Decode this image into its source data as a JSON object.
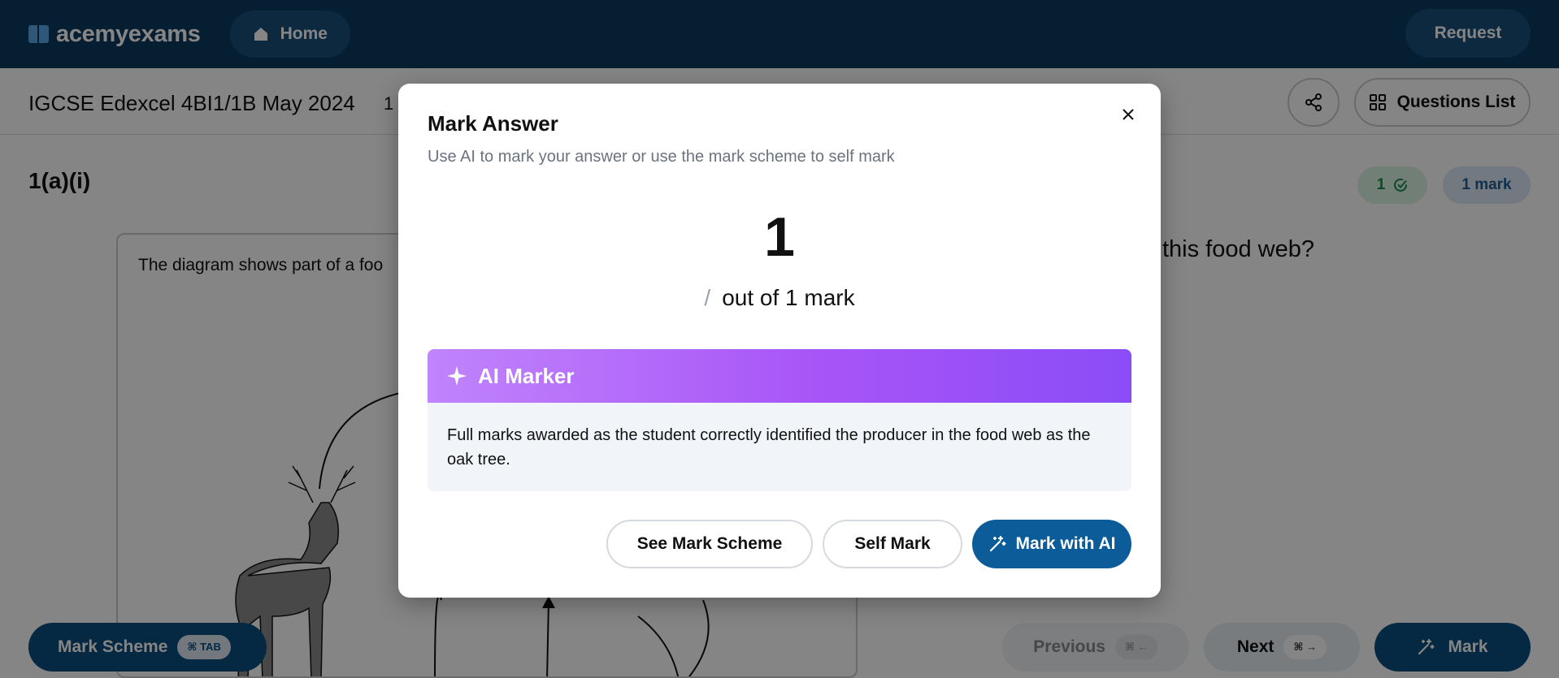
{
  "topbar": {
    "logo": "acemyexams",
    "home_label": "Home",
    "request_label": "Request"
  },
  "subheader": {
    "exam_title": "IGCSE Edexcel 4BI1/1B May 2024",
    "page_indicator": "1 /",
    "questions_list_label": "Questions List"
  },
  "question": {
    "label": "1(a)(i)",
    "completed_count": "1",
    "marks_badge": "1 mark",
    "diagram_text": "The diagram shows part of a foo",
    "question_text_visible": "this food web?"
  },
  "bottom": {
    "mark_scheme_label": "Mark Scheme",
    "mark_scheme_shortcut": "⌘ TAB",
    "previous_label": "Previous",
    "previous_shortcut": "⌘ ←",
    "next_label": "Next",
    "next_shortcut": "⌘ →",
    "mark_label": "Mark"
  },
  "modal": {
    "title": "Mark Answer",
    "subtitle": "Use AI to mark your answer or use the mark scheme to self mark",
    "score": "1",
    "slash": "/",
    "out_of": "out of 1 mark",
    "ai_marker_title": "AI Marker",
    "ai_feedback": "Full marks awarded as the student correctly identified the producer in the food web as the oak tree.",
    "see_mark_scheme_label": "See Mark Scheme",
    "self_mark_label": "Self Mark",
    "mark_with_ai_label": "Mark with AI"
  },
  "colors": {
    "navy": "#0b3a5f",
    "primary_button": "#0b5c98",
    "ai_gradient_start": "#c084fc",
    "ai_gradient_end": "#8b4cf7",
    "success_green": "#1f8a4c"
  },
  "icons": [
    "book-logo-icon",
    "home-icon",
    "share-icon",
    "grid-icon",
    "check-circle-icon",
    "close-icon",
    "sparkle-icon",
    "magic-wand-icon"
  ]
}
